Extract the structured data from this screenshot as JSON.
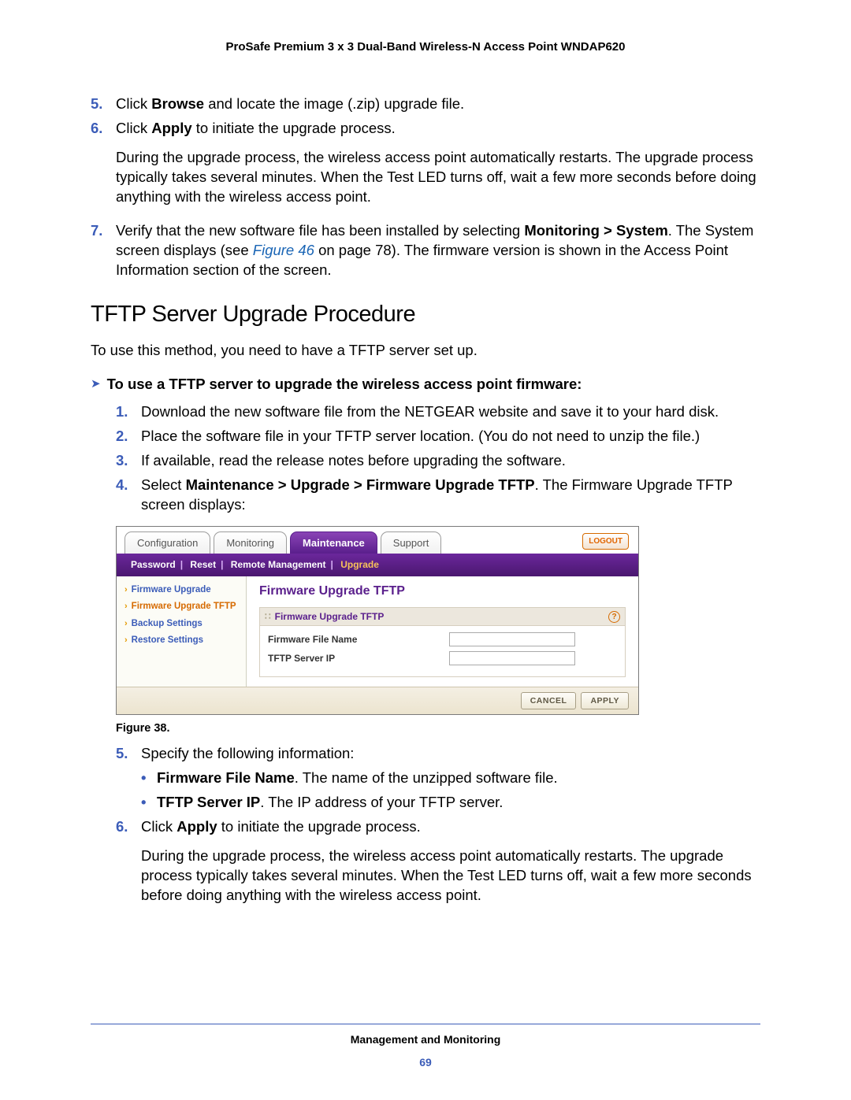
{
  "doc_header": "ProSafe Premium 3 x 3 Dual-Band Wireless-N Access Point WNDAP620",
  "steps_a": {
    "s5": {
      "num": "5.",
      "pre": "Click ",
      "b": "Browse",
      "post": " and locate the image (.zip) upgrade file."
    },
    "s6": {
      "num": "6.",
      "pre": "Click ",
      "b": "Apply",
      "post": " to initiate the upgrade process.",
      "para": "During the upgrade process, the wireless access point automatically restarts. The upgrade process typically takes several minutes. When the Test LED turns off, wait a few more seconds before doing anything with the wireless access point."
    },
    "s7": {
      "num": "7.",
      "t1": "Verify that the new software file has been installed by selecting ",
      "b1": "Monitoring > System",
      "t2": ". The System screen displays (see ",
      "link": "Figure 46",
      "t3": " on page 78). The firmware version is shown in the Access Point Information section of the screen."
    }
  },
  "h2": "TFTP Server Upgrade Procedure",
  "lead": "To use this method, you need to have a TFTP server set up.",
  "task": "To use a TFTP server to upgrade the wireless access point firmware:",
  "steps_b": {
    "s1": {
      "num": "1.",
      "t": "Download the new software file from the NETGEAR website and save it to your hard disk."
    },
    "s2": {
      "num": "2.",
      "t": "Place the software file in your TFTP server location. (You do not need to unzip the file.)"
    },
    "s3": {
      "num": "3.",
      "t": "If available, read the release notes before upgrading the software."
    },
    "s4": {
      "num": "4.",
      "pre": "Select ",
      "b": "Maintenance > Upgrade > Firmware Upgrade TFTP",
      "post": ". The Firmware Upgrade TFTP screen displays:"
    },
    "s5": {
      "num": "5.",
      "t": "Specify the following information:"
    },
    "s6": {
      "num": "6.",
      "pre": "Click ",
      "b": "Apply",
      "post": " to initiate the upgrade process.",
      "para": "During the upgrade process, the wireless access point automatically restarts. The upgrade process typically takes several minutes. When the Test LED turns off, wait a few more seconds before doing anything with the wireless access point."
    }
  },
  "bullets": {
    "a": {
      "b": "Firmware File Name",
      "t": ". The name of the unzipped software file."
    },
    "c": {
      "b": "TFTP Server IP",
      "t": ". The IP address of your TFTP server."
    }
  },
  "figure_caption": "Figure 38.",
  "ui": {
    "tabs": {
      "a": "Configuration",
      "b": "Monitoring",
      "c": "Maintenance",
      "d": "Support"
    },
    "logout": "LOGOUT",
    "subnav": {
      "a": "Password",
      "b": "Reset",
      "c": "Remote Management",
      "d": "Upgrade"
    },
    "side": {
      "a": "Firmware Upgrade",
      "b": "Firmware Upgrade TFTP",
      "c": "Backup Settings",
      "d": "Restore Settings"
    },
    "title": "Firmware Upgrade TFTP",
    "pane_title": "Firmware Upgrade TFTP",
    "row1": "Firmware File Name",
    "row2": "TFTP Server IP",
    "cancel": "CANCEL",
    "apply": "APPLY",
    "help": "?"
  },
  "footer": {
    "section": "Management and Monitoring",
    "page": "69"
  }
}
